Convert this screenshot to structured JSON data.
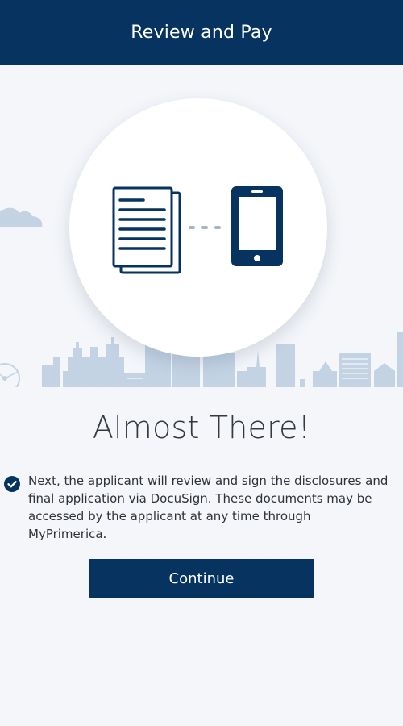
{
  "header": {
    "title": "Review and Pay"
  },
  "hero": {
    "documents_icon": "documents-icon",
    "connector_icon": "dotted-connector-icon",
    "phone_icon": "mobile-phone-icon",
    "background": "city-skyline"
  },
  "main": {
    "title": "Almost There!",
    "check_icon": "check-circle-icon",
    "message": "Next, the applicant will review and sign the disclosures and final application via DocuSign. These documents may be accessed by the applicant at any time through MyPrimerica.",
    "continue_label": "Continue"
  },
  "colors": {
    "primary": "#06335f",
    "background": "#f4f6fa",
    "skyline": "#c3d3e4"
  }
}
